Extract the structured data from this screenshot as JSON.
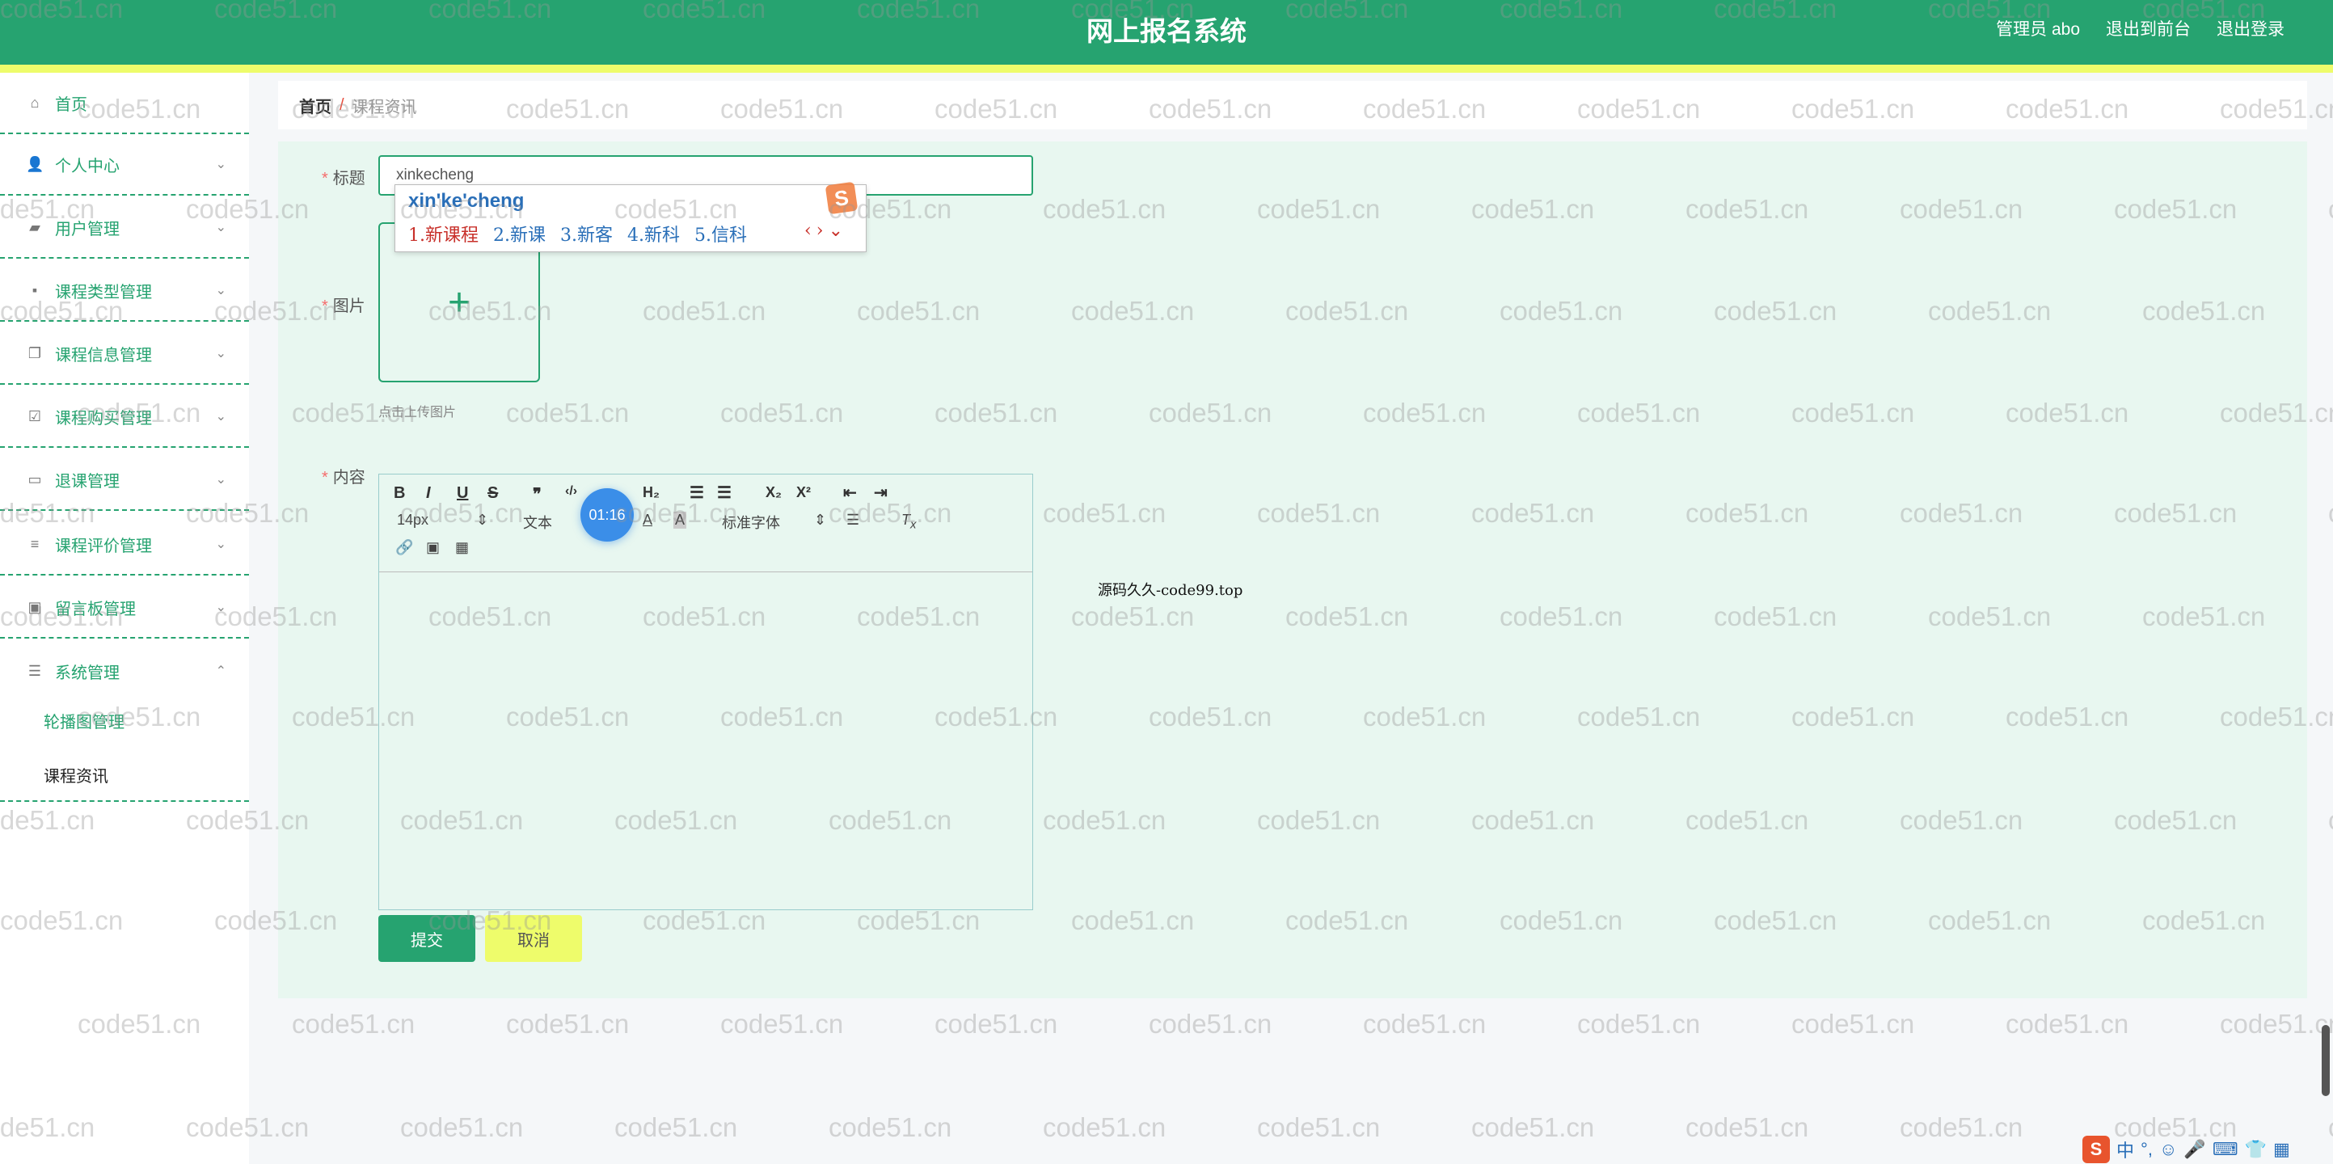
{
  "header": {
    "title": "网上报名系统",
    "user": "管理员 abo",
    "front_link": "退出到前台",
    "logout": "退出登录"
  },
  "sidebar": {
    "items": [
      {
        "label": "首页",
        "icon": "home-icon"
      },
      {
        "label": "个人中心",
        "icon": "user-icon"
      },
      {
        "label": "用户管理",
        "icon": "user-manage-icon"
      },
      {
        "label": "课程类型管理",
        "icon": "chat-icon"
      },
      {
        "label": "课程信息管理",
        "icon": "copy-icon"
      },
      {
        "label": "课程购买管理",
        "icon": "cart-icon"
      },
      {
        "label": "退课管理",
        "icon": "message-icon"
      },
      {
        "label": "课程评价管理",
        "icon": "list-icon"
      },
      {
        "label": "留言板管理",
        "icon": "briefcase-icon"
      },
      {
        "label": "系统管理",
        "icon": "sliders-icon"
      }
    ],
    "subitems": [
      {
        "label": "轮播图管理"
      },
      {
        "label": "课程资讯"
      }
    ]
  },
  "breadcrumb": {
    "home": "首页",
    "sep": "/",
    "current": "课程资讯"
  },
  "form": {
    "title_label": "标题",
    "title_value": "xinkecheng",
    "image_label": "图片",
    "upload_hint": "点击上传图片",
    "content_label": "内容",
    "font_size": "14px",
    "text_style": "文本",
    "font_family": "标准字体",
    "submit": "提交",
    "cancel": "取消"
  },
  "ime": {
    "pinyin": "xin'ke'cheng",
    "candidates": [
      "1.新课程",
      "2.新课",
      "3.新客",
      "4.新科",
      "5.信科"
    ]
  },
  "timer": "01:16",
  "code_note": "源码久久-code99.top",
  "watermark": "code51.cn",
  "colors": {
    "primary": "#26a370",
    "accent_yellow": "#eefc6b",
    "panel": "#e8f7f0"
  }
}
